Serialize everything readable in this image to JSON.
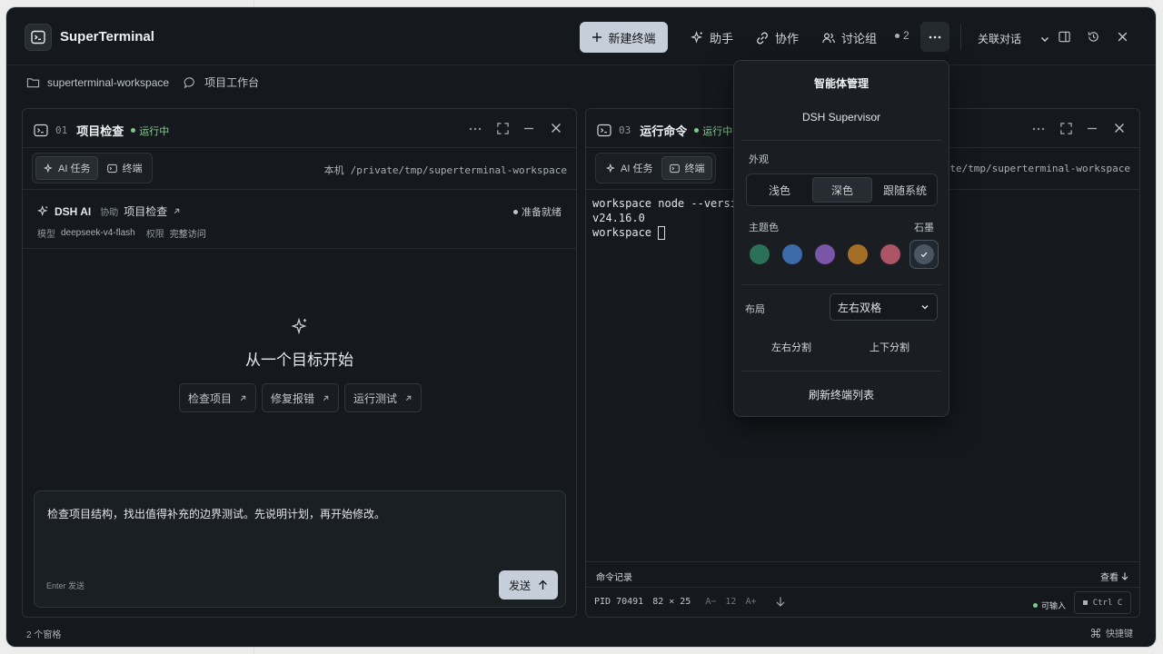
{
  "app": {
    "title": "SuperTerminal"
  },
  "toolbar": {
    "new_terminal": "新建终端",
    "assistant": "助手",
    "collaborate": "协作",
    "discussion": "讨论组",
    "count": "2",
    "link_chat": "关联对话"
  },
  "breadcrumb": {
    "workspace": "superterminal-workspace",
    "workbench": "项目工作台"
  },
  "pane1": {
    "num": "01",
    "title": "项目检查",
    "status": "运行中",
    "tab_ai": "AI 任务",
    "tab_terminal": "终端",
    "location_label": "本机",
    "path": "/private/tmp/superterminal-workspace",
    "agent_name": "DSH AI",
    "assist_label": "协助",
    "assist_target": "项目检查",
    "ready": "准备就绪",
    "model_label": "模型",
    "model_value": "deepseek-v4-flash",
    "perm_label": "权限",
    "perm_value": "完整访问",
    "empty_title": "从一个目标开始",
    "chips": [
      "检查项目",
      "修复报错",
      "运行测试"
    ],
    "prompt": "检查项目结构，找出值得补充的边界测试。先说明计划，再开始修改。",
    "enter_hint": "Enter 发送",
    "send": "发送"
  },
  "pane3": {
    "num": "03",
    "title": "运行命令",
    "status": "运行中",
    "tab_ai": "AI 任务",
    "tab_terminal": "终端",
    "path": "ivate/tmp/superterminal-workspace",
    "lines": [
      "workspace node --versi",
      "v24.16.0",
      "workspace "
    ],
    "history": "命令记录",
    "view": "查看",
    "pid": "PID 70491",
    "size": "82 × 25",
    "font_dec": "A−",
    "font_size": "12",
    "font_inc": "A+",
    "input_ok": "可输入",
    "ctrl_c": "Ctrl C"
  },
  "menu": {
    "title": "智能体管理",
    "supervisor": "DSH Supervisor",
    "appearance": "外观",
    "appearance_options": [
      "浅色",
      "深色",
      "跟随系统"
    ],
    "theme_label": "主题色",
    "theme_current": "石墨",
    "layout_label": "布局",
    "layout_value": "左右双格",
    "split_lr": "左右分割",
    "split_tb": "上下分割",
    "refresh": "刷新终端列表"
  },
  "colors": {
    "theme": [
      "#2b7058",
      "#3c6aa8",
      "#7a56a8",
      "#a46e27",
      "#ac5566",
      "#4b5563"
    ]
  },
  "statusbar": {
    "panes": "2 个窗格",
    "shortcuts": "快捷键"
  }
}
